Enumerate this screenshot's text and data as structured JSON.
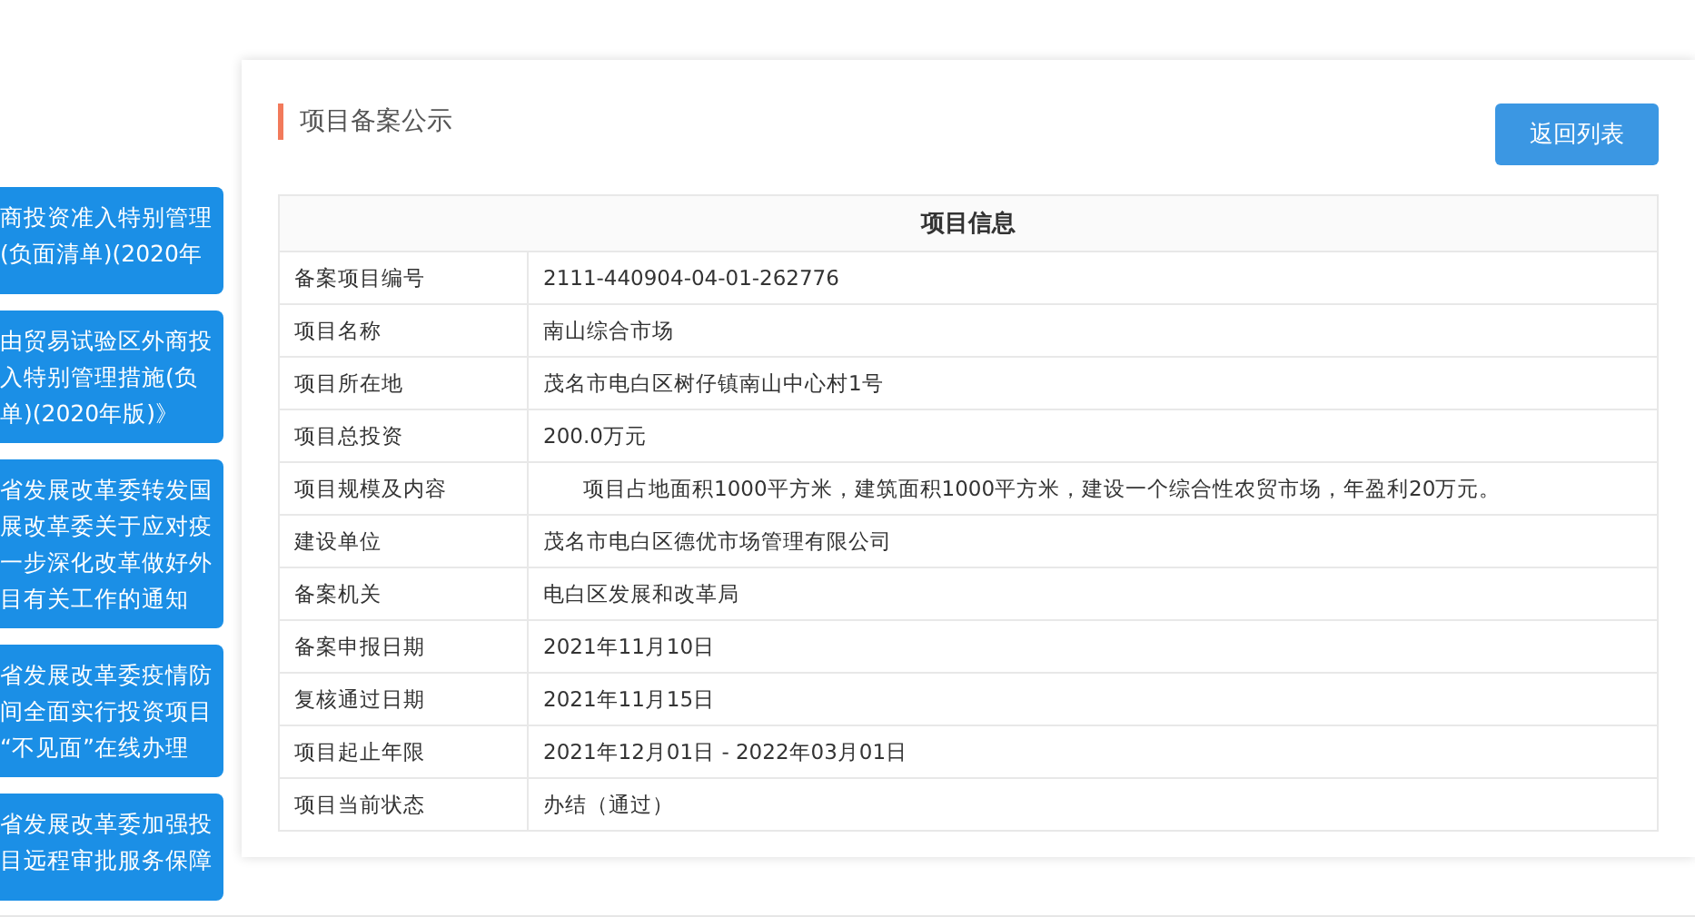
{
  "sidebar": {
    "items": [
      {
        "lines": [
          "商投资准入特别管理",
          "(负面清单)(2020年"
        ]
      },
      {
        "lines": [
          "由贸易试验区外商投",
          "入特别管理措施(负",
          "单)(2020年版)》"
        ]
      },
      {
        "lines": [
          "省发展改革委转发国",
          "展改革委关于应对疫",
          "一步深化改革做好外",
          "目有关工作的通知"
        ]
      },
      {
        "lines": [
          "省发展改革委疫情防",
          "间全面实行投资项目",
          "“不见面”在线办理"
        ]
      },
      {
        "lines": [
          "省发展改革委加强投",
          "目远程审批服务保障"
        ]
      }
    ]
  },
  "panel": {
    "title": "项目备案公示",
    "back_button": "返回列表",
    "table": {
      "heading": "项目信息",
      "rows": [
        {
          "label": "备案项目编号",
          "value": "2111-440904-04-01-262776"
        },
        {
          "label": "项目名称",
          "value": "南山综合市场"
        },
        {
          "label": "项目所在地",
          "value": "茂名市电白区树仔镇南山中心村1号"
        },
        {
          "label": "项目总投资",
          "value": "200.0万元"
        },
        {
          "label": "项目规模及内容",
          "value": "项目占地面积1000平方米，建筑面积1000平方米，建设一个综合性农贸市场，年盈利20万元。",
          "indent": true
        },
        {
          "label": "建设单位",
          "value": "茂名市电白区德优市场管理有限公司"
        },
        {
          "label": "备案机关",
          "value": "电白区发展和改革局"
        },
        {
          "label": "备案申报日期",
          "value": "2021年11月10日"
        },
        {
          "label": "复核通过日期",
          "value": "2021年11月15日"
        },
        {
          "label": "项目起止年限",
          "value": "2021年12月01日 - 2022年03月01日"
        },
        {
          "label": "项目当前状态",
          "value": "办结（通过）"
        }
      ]
    }
  }
}
